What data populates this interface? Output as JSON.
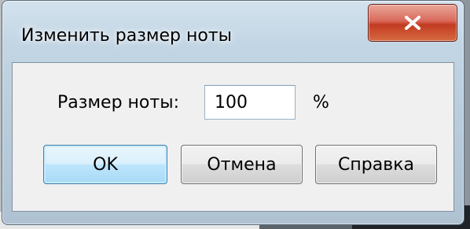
{
  "dialog": {
    "title": "Изменить размер ноты",
    "close_icon": "close-icon",
    "note_size": {
      "label": "Размер ноты:",
      "value": "100",
      "unit": "%"
    },
    "buttons": {
      "ok": "OK",
      "cancel": "Отмена",
      "help": "Справка"
    }
  },
  "colors": {
    "close_button": "#c23b22",
    "default_button_border": "#3c7fb1",
    "client_background": "#f0f0f0"
  }
}
